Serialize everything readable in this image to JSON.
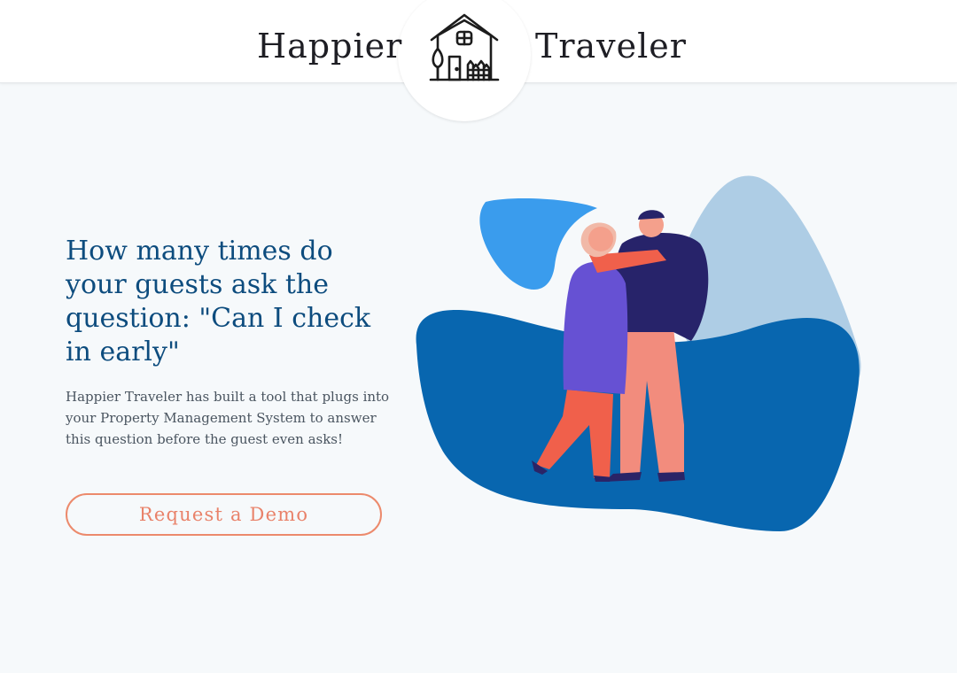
{
  "header": {
    "brand_left": "Happier",
    "brand_right": "Traveler",
    "logo_icon": "house-icon"
  },
  "hero": {
    "headline": "How many times do your guests ask the question: \"Can I check in early\"",
    "description": "Happier Traveler has built a tool that plugs into your Property Management System to answer this question before the guest even asks!",
    "cta_label": "Request a Demo"
  },
  "colors": {
    "headline": "#0d4c7e",
    "accent": "#ec8a6c",
    "blob_dark": "#0866af",
    "blob_light": "#aecde5",
    "blob_medium": "#3a9ced",
    "background": "#f6f9fb"
  }
}
